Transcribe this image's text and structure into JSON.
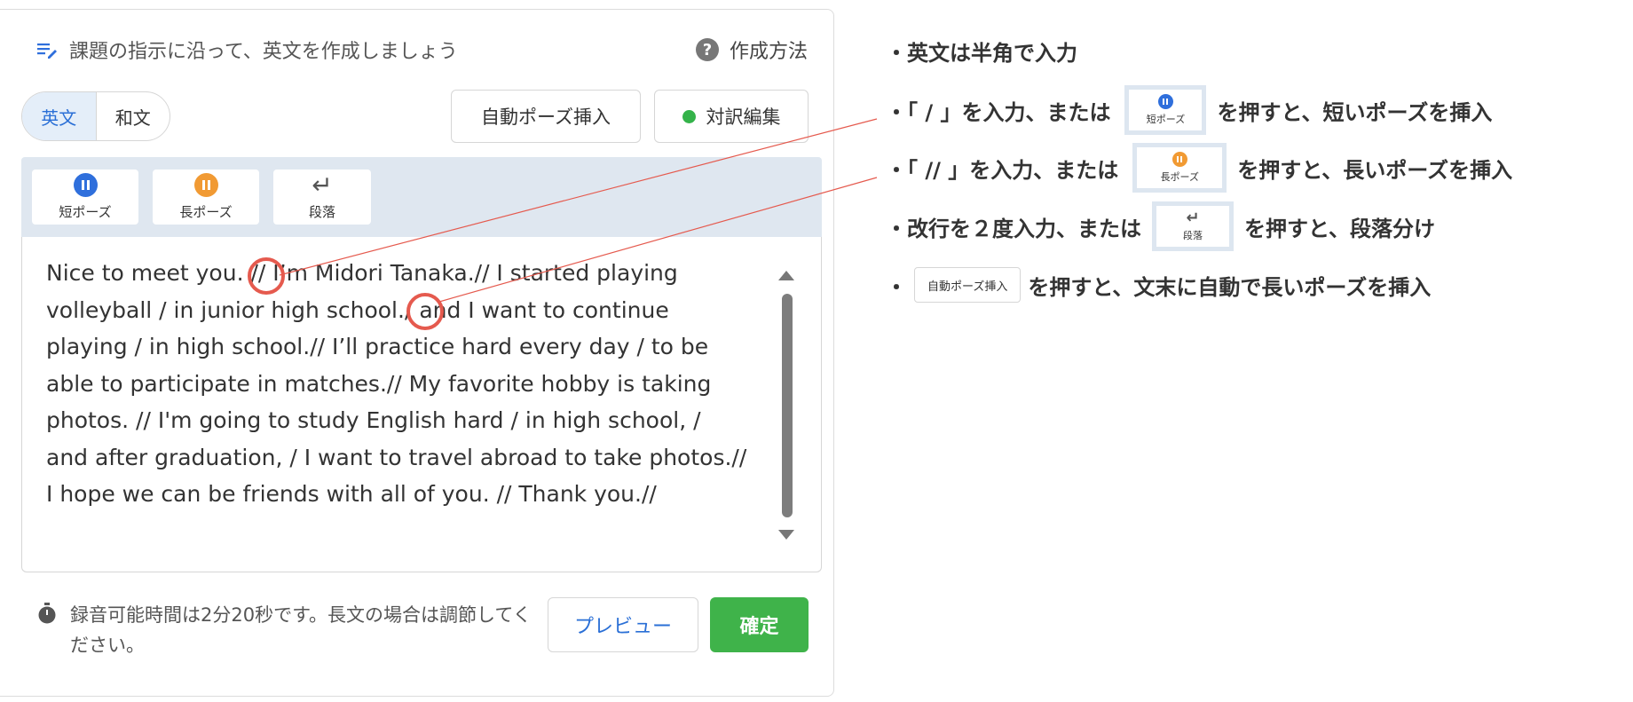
{
  "header": {
    "title": "課題の指示に沿って、英文を作成しましょう",
    "help_label": "作成方法"
  },
  "lang_toggle": {
    "english": "英文",
    "japanese": "和文",
    "active": "english"
  },
  "actions": {
    "auto_pause": "自動ポーズ挿入",
    "bilingual_edit": "対訳編集"
  },
  "toolbar": {
    "short_pause": "短ポーズ",
    "long_pause": "長ポーズ",
    "paragraph": "段落"
  },
  "editor": {
    "text": "Nice to meet you. // I’m Midori Tanaka.// I started playing volleyball / in junior high school./ and I want to continue playing / in high school.// I’ll practice hard every day / to be able to participate in matches.// My favorite hobby is taking photos. // I'm going to study English hard / in high school, / and after graduation, / I want to travel abroad to take photos.// I hope we can be friends with all of you. // Thank you.//"
  },
  "footer": {
    "note": "録音可能時間は2分20秒です。長文の場合は調節してください。",
    "preview": "プレビュー",
    "confirm": "確定"
  },
  "instructions": {
    "line1": "・英文は半角で入力",
    "line2_pre": "・「 / 」を入力、または",
    "line2_post": "を押すと、短いポーズを挿入",
    "line3_pre": "・「 // 」を入力、または",
    "line3_post": "を押すと、長いポーズを挿入",
    "line4_pre": "・改行を２度入力、または",
    "line4_post": "を押すと、段落分け",
    "line5_pre": "・",
    "line5_post": "を押すと、文末に自動で長いポーズを挿入",
    "mini_short": "短ポーズ",
    "mini_long": "長ポーズ",
    "mini_para": "段落",
    "mini_auto": "自動ポーズ挿入"
  },
  "colors": {
    "accent_blue": "#2f6fdc",
    "pause_orange": "#f19a33",
    "confirm_green": "#3fb34a",
    "callout_red": "#e55a4e",
    "toolbar_bg": "#dfe7f0"
  },
  "icons": [
    "edit-note-icon",
    "help-icon",
    "short-pause-icon",
    "long-pause-icon",
    "enter-icon",
    "timer-icon"
  ]
}
